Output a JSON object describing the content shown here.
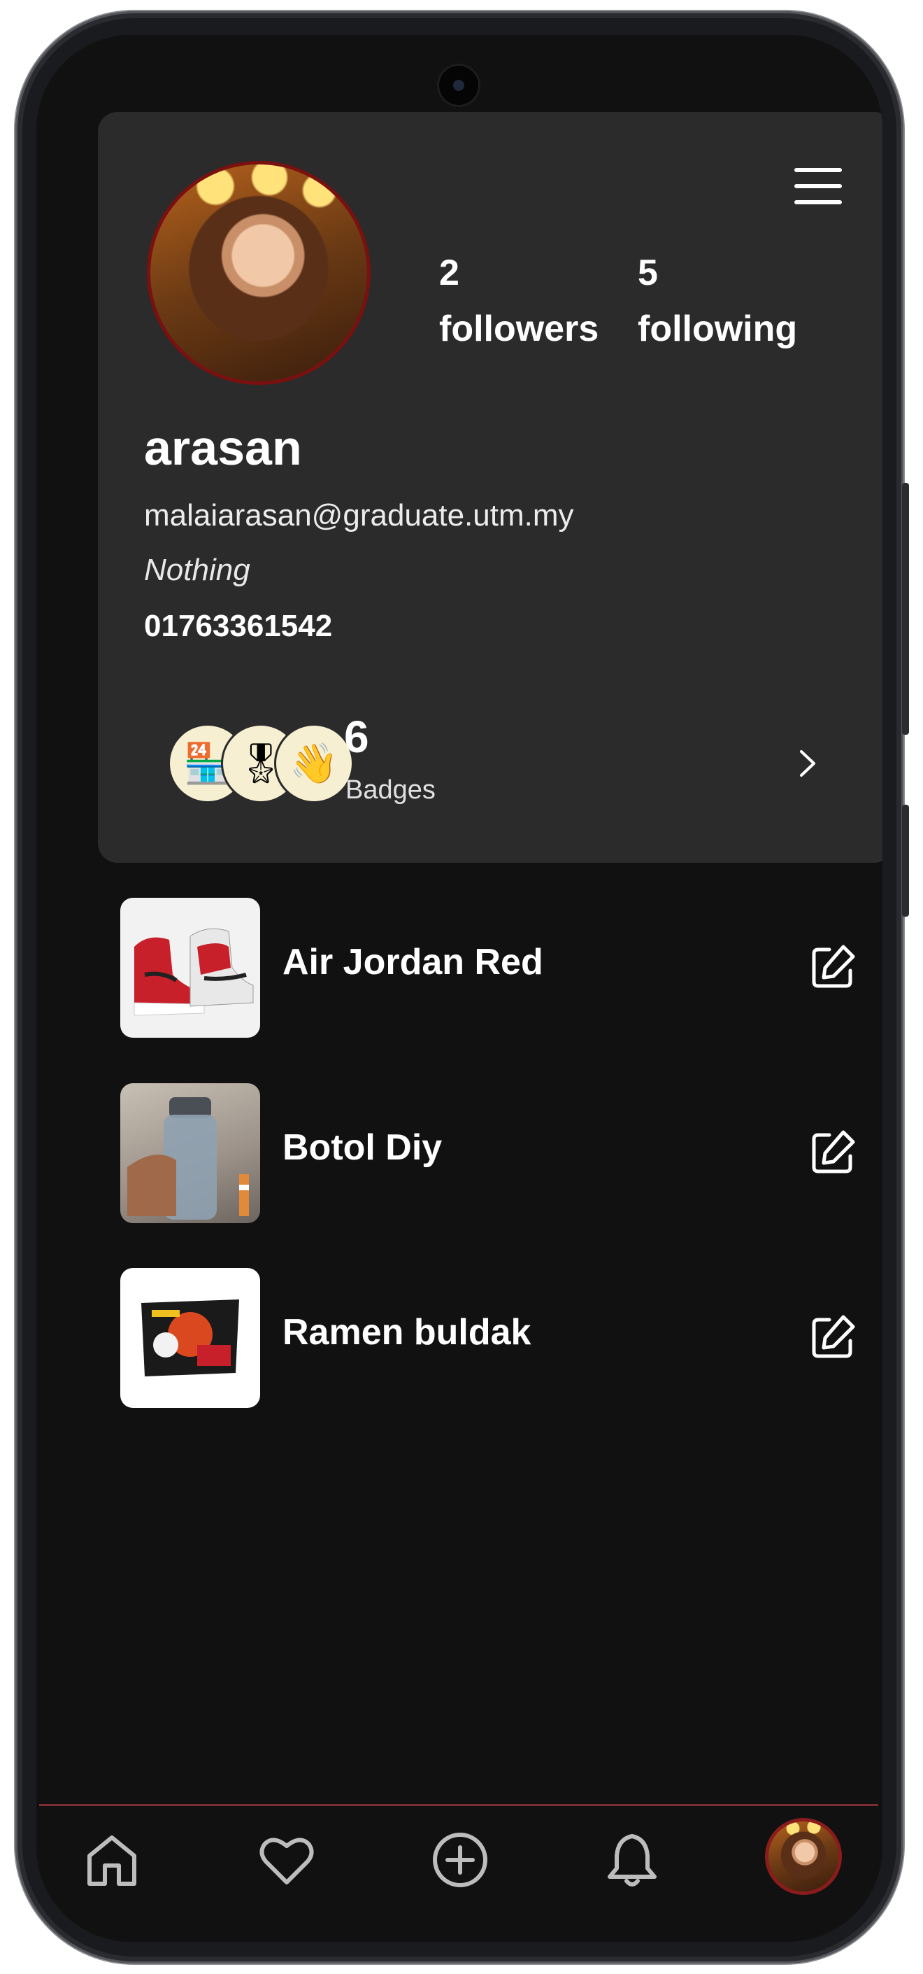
{
  "profile": {
    "followers_count": "2",
    "followers_label": "followers",
    "following_count": "5",
    "following_label": "following",
    "username": "arasan",
    "email": "malaiarasan@graduate.utm.my",
    "bio": "Nothing",
    "phone": "01763361542",
    "menu_icon": "hamburger-menu-icon"
  },
  "badges": {
    "count": "6",
    "label": "Badges",
    "icons": [
      "🏪",
      "🎖",
      "👋"
    ]
  },
  "items": [
    {
      "title": "Air Jordan Red",
      "thumb": "sneaker-image"
    },
    {
      "title": "Botol Diy",
      "thumb": "water-bottle-image"
    },
    {
      "title": "Ramen buldak",
      "thumb": "ramen-package-image"
    }
  ],
  "nav": {
    "items": [
      "home-icon",
      "heart-icon",
      "add-circle-icon",
      "bell-icon",
      "profile-avatar"
    ],
    "accent": "#7e2c34"
  },
  "colors": {
    "background": "#111111",
    "card": "#2b2b2b",
    "text": "#ffffff",
    "avatar_border": "#7a1010"
  }
}
